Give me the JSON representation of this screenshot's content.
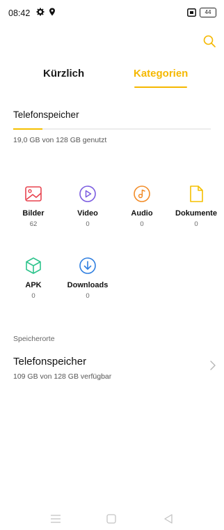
{
  "status_bar": {
    "time": "08:42",
    "battery": "44",
    "icons": [
      "gear-icon",
      "location-pin-icon",
      "cast-icon",
      "battery-icon"
    ]
  },
  "header": {
    "search_icon": "search-icon",
    "tabs": [
      {
        "label": "Kürzlich",
        "active": false
      },
      {
        "label": "Kategorien",
        "active": true
      }
    ],
    "accent_color": "#f5b800"
  },
  "storage": {
    "title": "Telefonspeicher",
    "used_text": "19,0 GB von 128 GB genutzt",
    "used_fraction": 0.148
  },
  "categories": [
    {
      "label": "Bilder",
      "count": "62",
      "icon": "image-icon",
      "color": "#e8424e"
    },
    {
      "label": "Video",
      "count": "0",
      "icon": "video-play-icon",
      "color": "#7b5ce0"
    },
    {
      "label": "Audio",
      "count": "0",
      "icon": "music-note-icon",
      "color": "#f28c28"
    },
    {
      "label": "Dokumente",
      "count": "0",
      "icon": "document-icon",
      "color": "#f5c000"
    },
    {
      "label": "APK",
      "count": "0",
      "icon": "apk-cube-icon",
      "color": "#2fc48d"
    },
    {
      "label": "Downloads",
      "count": "0",
      "icon": "download-icon",
      "color": "#2f7fe0"
    }
  ],
  "locations": {
    "section_label": "Speicherorte",
    "items": [
      {
        "title": "Telefonspeicher",
        "subtitle": "109 GB von 128 GB verfügbar"
      }
    ]
  },
  "nav_bar": {
    "icons": [
      "menu-icon",
      "home-square-icon",
      "back-triangle-icon"
    ]
  }
}
